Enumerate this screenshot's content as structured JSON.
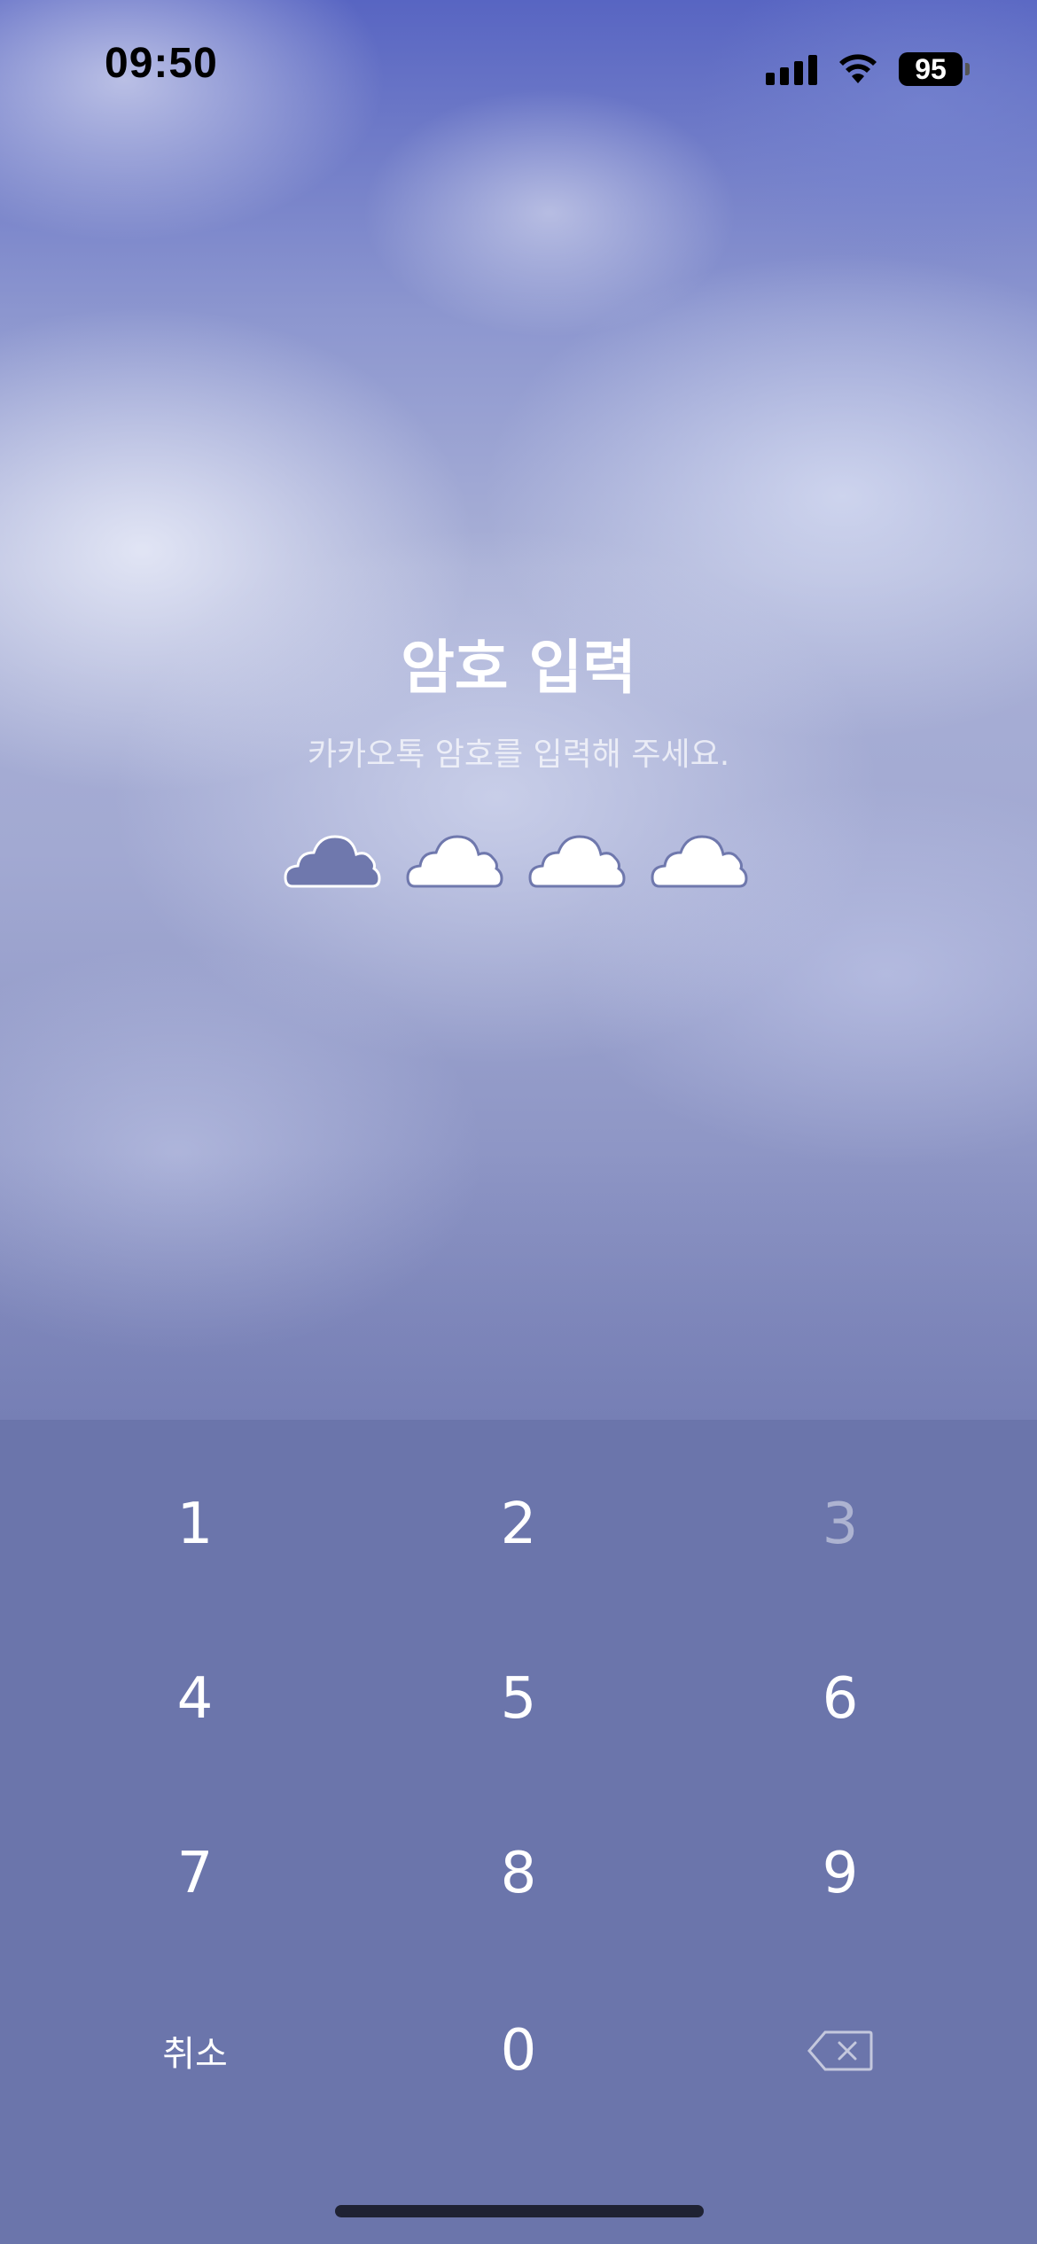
{
  "status_bar": {
    "time": "09:50",
    "battery": "95",
    "signal_icon": "cellular-signal",
    "wifi_icon": "wifi"
  },
  "lock_screen": {
    "title": "암호 입력",
    "subtitle": "카카오톡 암호를 입력해 주세요.",
    "pin_length": 4,
    "pin_entered": 1,
    "filled_color": "#6f78ad",
    "empty_color": "#ffffff"
  },
  "keypad": {
    "keys": [
      "1",
      "2",
      "3",
      "4",
      "5",
      "6",
      "7",
      "8",
      "9"
    ],
    "cancel_label": "취소",
    "zero": "0",
    "backspace_icon": "backspace",
    "background_color": "#6b75ab"
  }
}
